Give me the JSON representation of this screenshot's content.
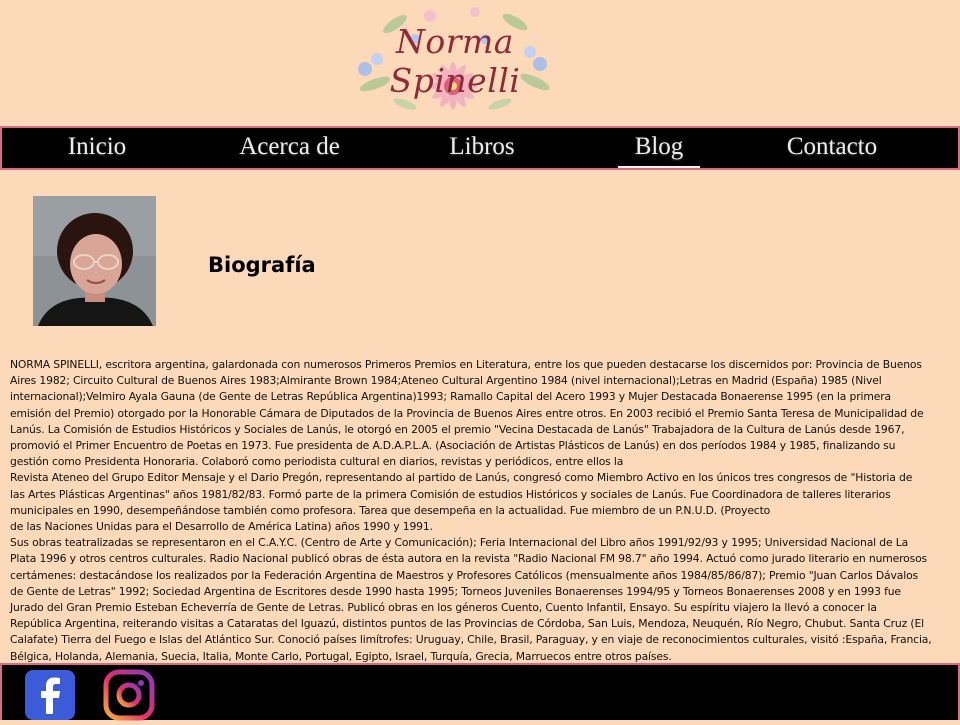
{
  "site": {
    "logo_text": "Norma Spinelli"
  },
  "nav": {
    "items": [
      {
        "label": "Inicio"
      },
      {
        "label": "Acerca de"
      },
      {
        "label": "Libros"
      },
      {
        "label": "Blog"
      },
      {
        "label": "Contacto"
      }
    ],
    "active": "Blog"
  },
  "colors": {
    "background": "#fcd9b8",
    "nav_background": "#000000",
    "nav_border": "#d96b86",
    "logo_text": "#8e2a3a"
  },
  "main": {
    "heading": "Biografía",
    "bio_lines": [
      "NORMA SPINELLI, escritora argentina, galardonada con numerosos Primeros Premios en Literatura, entre los que pueden destacarse los discernidos por: Provincia de Buenos",
      "Aires 1982; Circuito Cultural de Buenos Aires 1983;Almirante Brown 1984;Ateneo Cultural Argentino 1984 (nivel internacional);Letras en Madrid (España) 1985 (Nivel",
      "internacional);Velmiro Ayala Gauna (de Gente de Letras República Argentina)1993; Ramallo Capital del Acero 1993 y Mujer Destacada Bonaerense 1995 (en la primera",
      "emisión del Premio) otorgado por la Honorable Cámara de Diputados de la Provincia de Buenos Aires entre otros. En 2003 recibió el Premio Santa Teresa de Municipalidad de",
      "Lanús. La Comisión de Estudios Históricos y Sociales de Lanús, le otorgó en 2005 el premio \"Vecina Destacada de Lanús\" Trabajadora de la Cultura de Lanús desde 1967,",
      "promovió el Primer Encuentro de Poetas en 1973. Fue presidenta de A.D.A.P.L.A. (Asociación de Artistas Plásticos de Lanús) en dos períodos 1984 y 1985, finalizando su",
      "gestión como Presidenta Honoraria. Colaboró como periodista cultural en diarios, revistas y periódicos, entre ellos la",
      "Revista Ateneo del Grupo Editor Mensaje y el Dario Pregón, representando al partido de Lanús, congresó como Miembro Activo en los únicos tres congresos de \"Historia de",
      "las Artes Plásticas Argentinas\" años 1981/82/83. Formó parte de la primera Comisión de estudios Históricos y sociales de Lanús. Fue Coordinadora de talleres literarios",
      "municipales en 1990, desempeñándose también como profesora. Tarea que desempeña en la actualidad. Fue miembro de un P.N.U.D. (Proyecto",
      "de las Naciones Unidas para el Desarrollo de América Latina) años 1990 y 1991.",
      "Sus obras teatralizadas se representaron en el C.A.Y.C. (Centro de Arte y Comunicación); Feria Internacional del Libro años 1991/92/93 y 1995; Universidad Nacional de La",
      "Plata 1996 y otros centros culturales. Radio Nacional publicó obras de ésta autora en la revista \"Radio Nacional FM 98.7\" año 1994. Actuó como jurado literario en numerosos",
      "certámenes: destacándose los realizados por la Federación Argentina de Maestros y Profesores Católicos (mensualmente años 1984/85/86/87); Premio \"Juan Carlos Dávalos",
      "de Gente de Letras\" 1992; Sociedad Argentina de Escritores desde 1990 hasta 1995; Torneos Juveniles Bonaerenses 1994/95 y Torneos Bonaerenses 2008 y en 1993 fue",
      "Jurado del Gran Premio Esteban Echeverría de Gente de Letras. Publicó obras en los géneros Cuento, Cuento Infantil, Ensayo. Su espíritu viajero la llevó a conocer la",
      "República Argentina, reiterando visitas a Cataratas del Iguazú, distintos puntos de las Provincias de Córdoba, San Luis, Mendoza, Neuquén, Río Negro, Chubut. Santa Cruz (El",
      "Calafate) Tierra del Fuego e Islas del Atlántico Sur. Conoció países limítrofes: Uruguay, Chile, Brasil, Paraguay, y en viaje de reconocimientos culturales, visitó :España, Francia,",
      "Bélgica, Holanda, Alemania, Suecia, Italia, Monte Carlo, Portugal, Egipto, Israel, Turquía, Grecia, Marruecos entre otros países."
    ]
  },
  "footer": {
    "social": [
      {
        "icon": "facebook-icon"
      },
      {
        "icon": "instagram-icon"
      }
    ]
  }
}
